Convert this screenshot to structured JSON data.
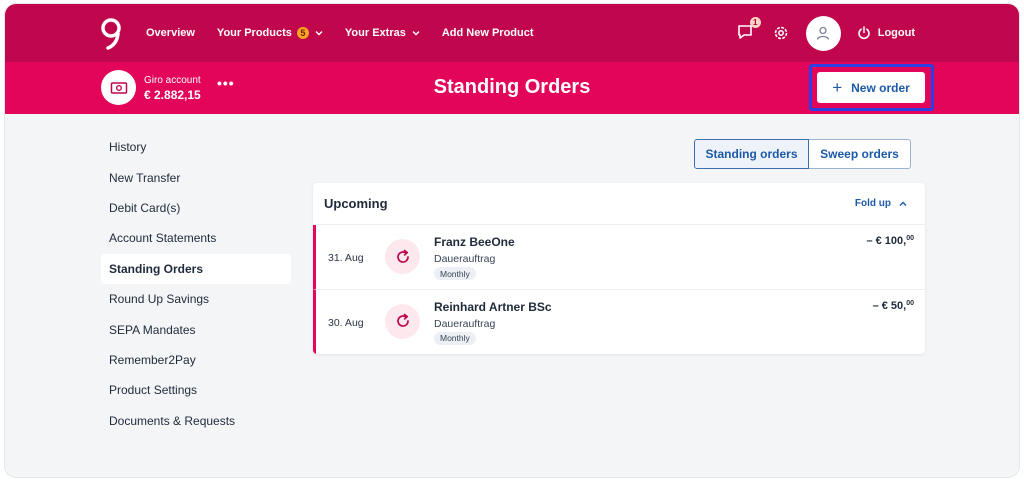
{
  "nav": {
    "links": [
      {
        "label": "Overview"
      },
      {
        "label": "Your Products",
        "badge": "5",
        "dropdown": true
      },
      {
        "label": "Your Extras",
        "dropdown": true
      },
      {
        "label": "Add New Product"
      }
    ],
    "messages_badge": "1",
    "logout_label": "Logout",
    "icons": [
      "logo-icon",
      "chat-icon",
      "gear-icon",
      "user-icon",
      "power-icon"
    ]
  },
  "account": {
    "name": "Giro account",
    "balance": "€ 2.882,15",
    "more_label": "•••"
  },
  "page": {
    "title": "Standing Orders",
    "new_order_label": "New order"
  },
  "sidebar": {
    "items": [
      {
        "label": "History"
      },
      {
        "label": "New Transfer"
      },
      {
        "label": "Debit Card(s)"
      },
      {
        "label": "Account Statements"
      },
      {
        "label": "Standing Orders",
        "active": true
      },
      {
        "label": "Round Up Savings"
      },
      {
        "label": "SEPA Mandates"
      },
      {
        "label": "Remember2Pay"
      },
      {
        "label": "Product Settings"
      },
      {
        "label": "Documents & Requests"
      }
    ]
  },
  "toggle": {
    "standing_label": "Standing orders",
    "sweep_label": "Sweep orders"
  },
  "upcoming": {
    "title": "Upcoming",
    "fold_label": "Fold up",
    "orders": [
      {
        "date": "31. Aug",
        "name": "Franz BeeOne",
        "type": "Dauerauftrag",
        "frequency": "Monthly",
        "amount": "– € 100,",
        "cents": "00"
      },
      {
        "date": "30. Aug",
        "name": "Reinhard Artner BSc",
        "type": "Dauerauftrag",
        "frequency": "Monthly",
        "amount": "– € 50,",
        "cents": "00"
      }
    ]
  },
  "colors": {
    "nav_bg": "#c0064c",
    "account_bar_bg": "#e2055a",
    "link_blue": "#1c5aa8",
    "highlight": "#2c3fe0"
  }
}
